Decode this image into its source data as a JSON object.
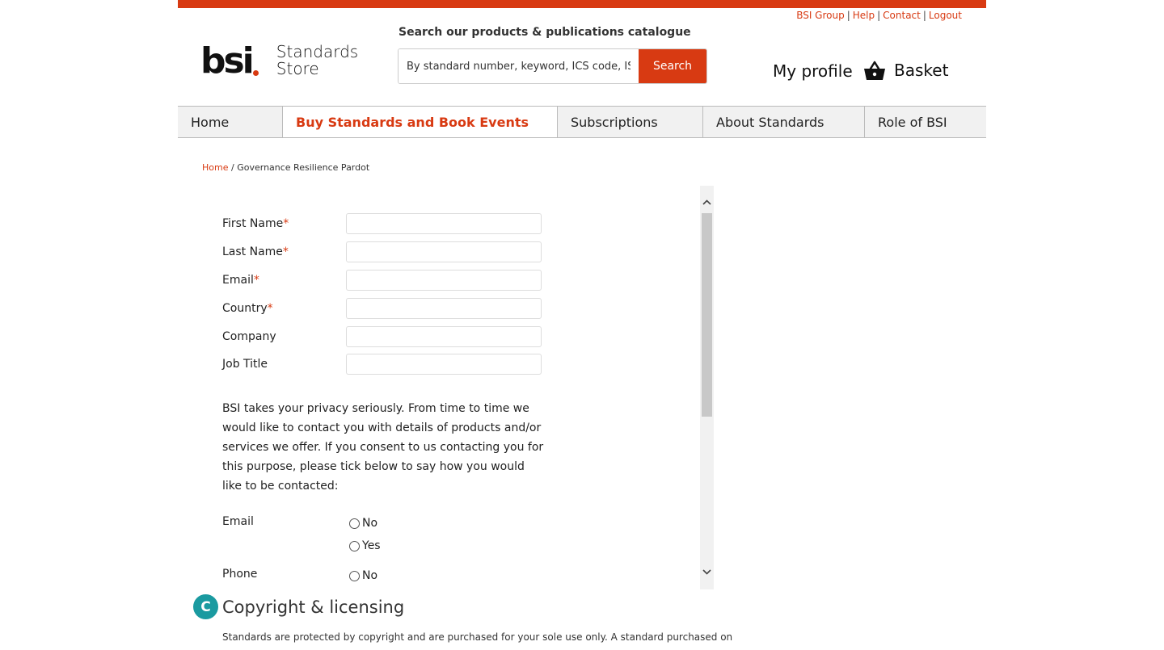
{
  "utility_links": [
    "BSI Group",
    "Help",
    "Contact",
    "Logout"
  ],
  "logo": {
    "brand": "bsi",
    "store_line1": "Standards",
    "store_line2": "Store"
  },
  "search": {
    "label": "Search our products & publications catalogue",
    "placeholder": "By standard number, keyword, ICS code, IS",
    "button": "Search"
  },
  "account": {
    "profile": "My profile",
    "basket": "Basket"
  },
  "nav": [
    {
      "label": "Home",
      "active": false
    },
    {
      "label": "Buy Standards and Book Events",
      "active": true
    },
    {
      "label": "Subscriptions",
      "active": false
    },
    {
      "label": "About Standards",
      "active": false
    },
    {
      "label": "Role of BSI",
      "active": false
    }
  ],
  "breadcrumb": {
    "home": "Home",
    "separator": "/",
    "current": "Governance Resilience Pardot"
  },
  "form": {
    "fields": [
      {
        "label": "First Name",
        "required": true,
        "value": ""
      },
      {
        "label": "Last Name",
        "required": true,
        "value": ""
      },
      {
        "label": "Email",
        "required": true,
        "value": ""
      },
      {
        "label": "Country",
        "required": true,
        "value": ""
      },
      {
        "label": "Company",
        "required": false,
        "value": ""
      },
      {
        "label": "Job Title",
        "required": false,
        "value": ""
      }
    ],
    "required_marker": "*",
    "privacy_text": "BSI takes your privacy seriously. From time to time we would like to contact you with details of products and/or services we offer. If you consent to us contacting you for this purpose, please tick below to say how you would like to be contacted:",
    "preferences": {
      "email_label": "Email",
      "phone_label": "Phone",
      "option_no": "No",
      "option_yes": "Yes"
    }
  },
  "copyright": {
    "badge": "C",
    "title": "Copyright & licensing",
    "text": "Standards are protected by copyright and are purchased for your sole use only. A standard purchased on"
  },
  "colors": {
    "brand_red": "#d83a12",
    "teal": "#1a9aa0"
  }
}
